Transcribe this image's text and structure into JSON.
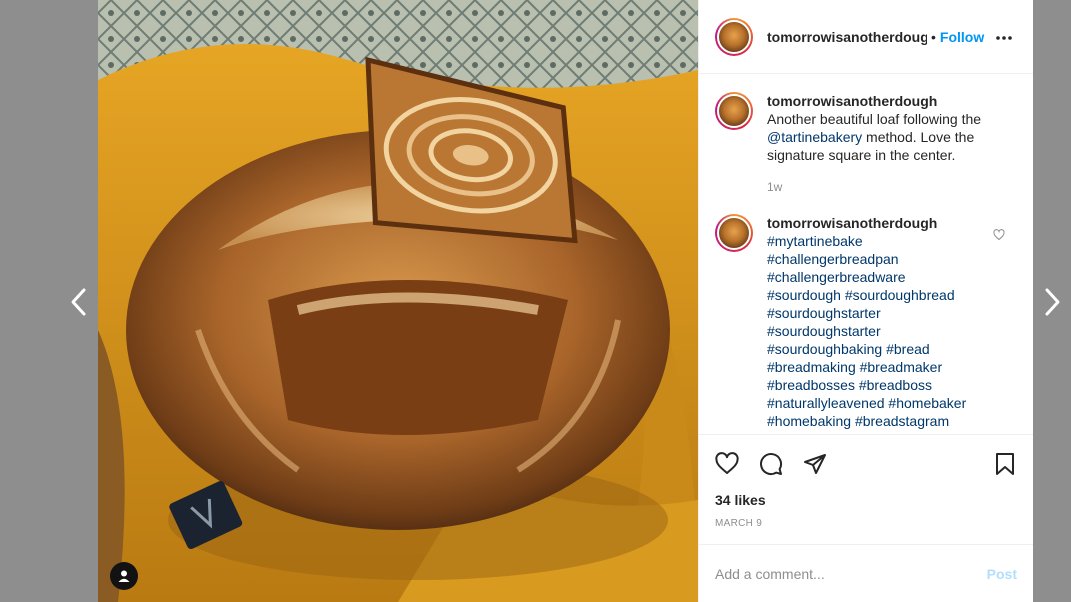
{
  "post": {
    "username": "tomorrowisanotherdough",
    "separator": "•",
    "follow_label": "Follow",
    "more_icon": "more-options-icon",
    "caption": {
      "username": "tomorrowisanotherdough",
      "text_before": "Another beautiful loaf following the ",
      "mention": "@tartinebakery",
      "text_after": " method. Love the signature square in the center.",
      "time": "1w"
    },
    "comment": {
      "username": "tomorrowisanotherdough",
      "hashtags": [
        "#mytartinebake",
        "#challengerbreadpan",
        "#challengerbreadware",
        "#sourdough #sourdoughbread",
        "#sourdoughstarter",
        "#sourdoughstarter",
        "#sourdoughbaking #bread",
        "#breadmaking #breadmaker",
        "#breadbosses #breadboss",
        "#naturallyleavened #homebaker",
        "#homebaking #breadstagram"
      ]
    },
    "likes": "34 likes",
    "date": "MARCH 9",
    "add_comment_placeholder": "Add a comment...",
    "post_label": "Post"
  },
  "colors": {
    "link_blue": "#0095f6",
    "hashtag_blue": "#00376b",
    "post_disabled": "#b2dffc",
    "backdrop": "#8e8e8e"
  },
  "icons": [
    "chevron-left-icon",
    "chevron-right-icon",
    "user-tag-icon",
    "heart-icon",
    "comment-icon",
    "share-icon",
    "bookmark-icon"
  ]
}
